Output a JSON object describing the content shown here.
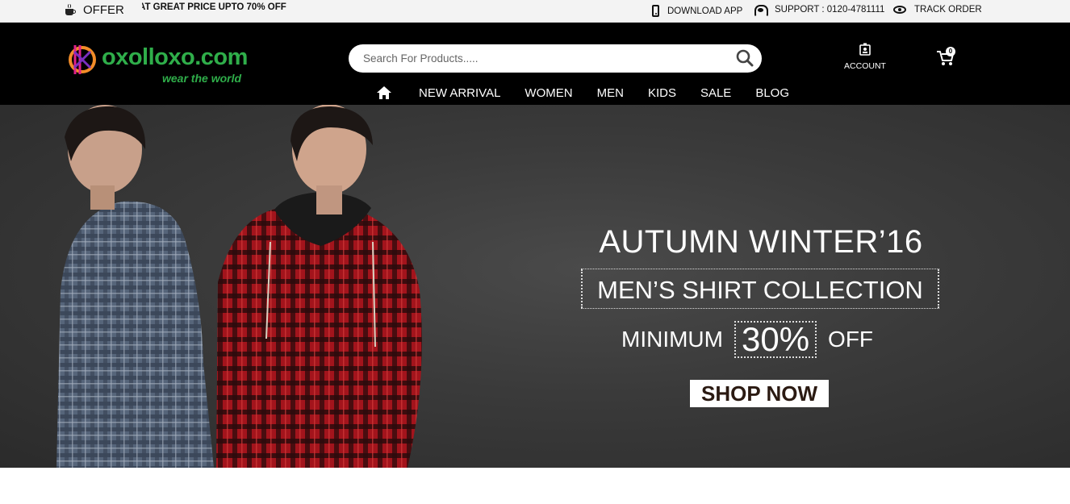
{
  "topbar": {
    "offer_label": "OFFER",
    "offer_marquee": "AT GREAT PRICE UPTO 70% OFF",
    "download_app": "DOWNLOAD APP",
    "support": "SUPPORT : 0120-4781111",
    "track_order": "TRACK ORDER"
  },
  "brand": {
    "name": "oxolloxo.com",
    "tagline": "wear the world",
    "color": "#2fae4a"
  },
  "search": {
    "placeholder": "Search For Products....."
  },
  "account": {
    "label": "ACCOUNT"
  },
  "cart": {
    "count": "0"
  },
  "nav": {
    "items": [
      "NEW ARRIVAL",
      "WOMEN",
      "MEN",
      "KIDS",
      "SALE",
      "BLOG"
    ]
  },
  "hero": {
    "title": "AUTUMN WINTER’16",
    "subtitle": "MEN’S SHIRT COLLECTION",
    "min_label": "MINIMUM",
    "percent": "30%",
    "off_label": "OFF",
    "cta": "SHOP NOW"
  },
  "colors": {
    "header_bg": "#000000",
    "topbar_bg": "#f3f3f3",
    "hero_bg": "#3a3a3a"
  }
}
